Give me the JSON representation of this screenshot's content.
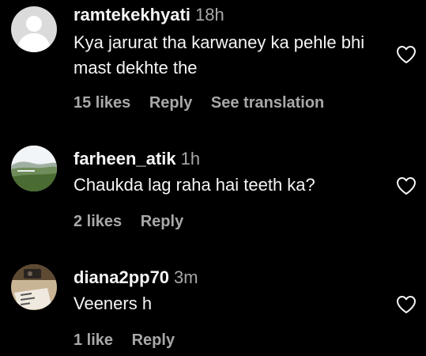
{
  "comments": [
    {
      "username": "ramtekekhyati",
      "time": "18h",
      "text": "Kya jarurat tha karwaney ka pehle bhi mast dekhte the",
      "likes": "15 likes",
      "reply": "Reply",
      "translate": "See translation",
      "avatar_icon": "default-profile-icon"
    },
    {
      "username": "farheen_atik",
      "time": "1h",
      "text": "Chaukda lag raha hai teeth ka?",
      "likes": "2 likes",
      "reply": "Reply",
      "avatar_icon": "landscape-photo"
    },
    {
      "username": "diana2pp70",
      "time": "3m",
      "text": "Veeners h",
      "likes": "1 like",
      "reply": "Reply",
      "avatar_icon": "album-photo"
    }
  ],
  "icons": {
    "like": "heart-outline-icon"
  },
  "colors": {
    "background": "#000000",
    "primary_text": "#f5f5f5",
    "secondary_text": "#a8a8a8"
  }
}
